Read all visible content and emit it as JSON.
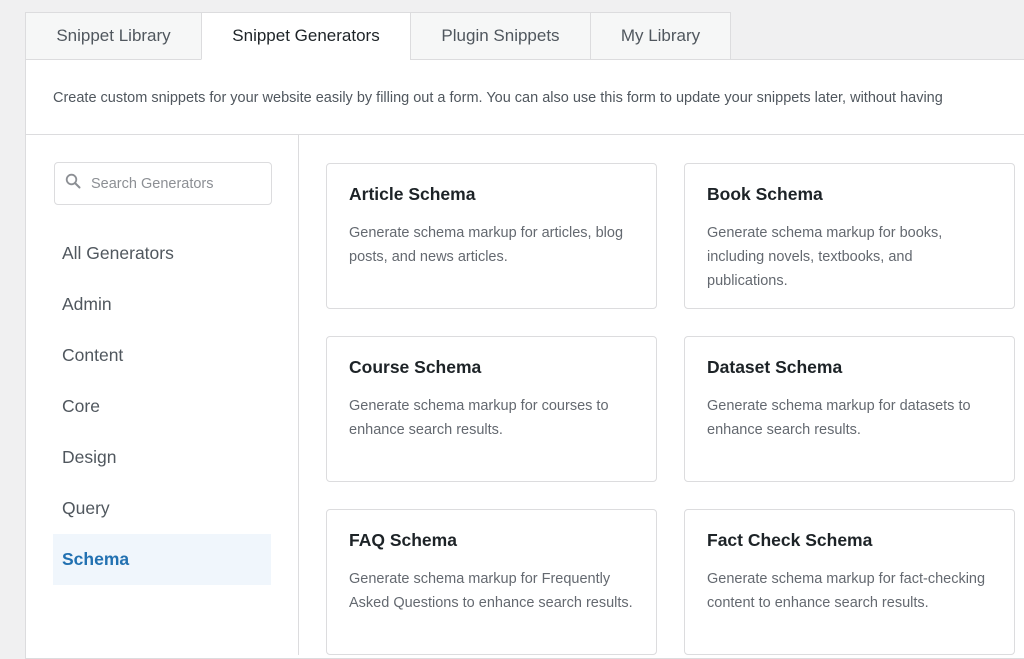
{
  "tabs": [
    {
      "label": "Snippet Library"
    },
    {
      "label": "Snippet Generators"
    },
    {
      "label": "Plugin Snippets"
    },
    {
      "label": "My Library"
    }
  ],
  "active_tab": "Snippet Generators",
  "description": "Create custom snippets for your website easily by filling out a form. You can also use this form to update your snippets later, without having",
  "search": {
    "placeholder": "Search Generators",
    "icon": "search-icon"
  },
  "categories": [
    {
      "label": "All Generators"
    },
    {
      "label": "Admin"
    },
    {
      "label": "Content"
    },
    {
      "label": "Core"
    },
    {
      "label": "Design"
    },
    {
      "label": "Query"
    },
    {
      "label": "Schema"
    }
  ],
  "active_category": "Schema",
  "generators": [
    {
      "title": "Article Schema",
      "description": "Generate schema markup for articles, blog posts, and news articles."
    },
    {
      "title": "Book Schema",
      "description": "Generate schema markup for books, including novels, textbooks, and publications."
    },
    {
      "title": "Course Schema",
      "description": "Generate schema markup for courses to enhance search results."
    },
    {
      "title": "Dataset Schema",
      "description": "Generate schema markup for datasets to enhance search results."
    },
    {
      "title": "FAQ Schema",
      "description": "Generate schema markup for Frequently Asked Questions to enhance search results."
    },
    {
      "title": "Fact Check Schema",
      "description": "Generate schema markup for fact-checking content to enhance search results."
    }
  ],
  "colors": {
    "accent": "#2271b1",
    "active_bg": "#f0f6fc",
    "border": "#dcdcde"
  }
}
